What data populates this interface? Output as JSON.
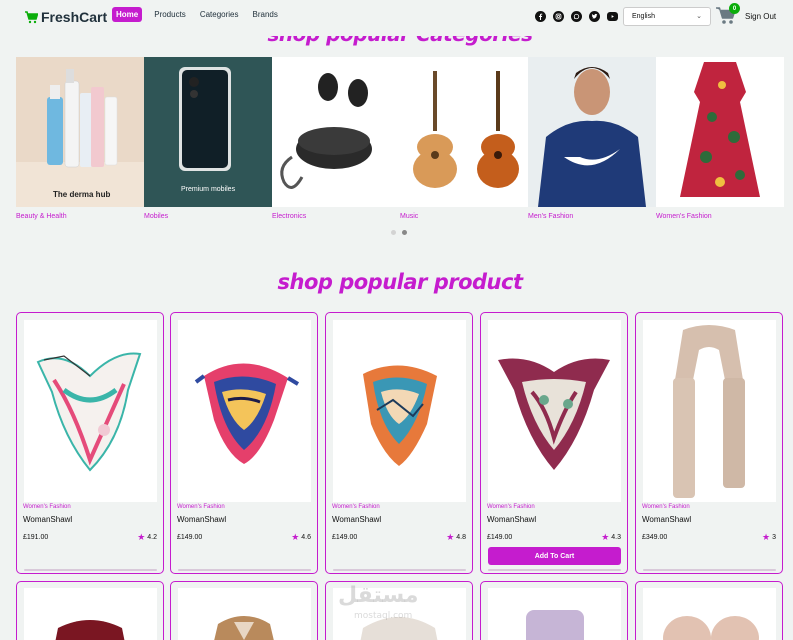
{
  "brand": {
    "name": "FreshCart",
    "icon": "cart-icon",
    "color": "#0aad0a"
  },
  "nav": {
    "links": [
      "Home",
      "Products",
      "Categories",
      "Brands"
    ],
    "active": "Home"
  },
  "socials": [
    "facebook-icon",
    "instagram-icon",
    "whatsapp-icon",
    "twitter-icon",
    "youtube-icon"
  ],
  "language": {
    "selected": "English"
  },
  "cart": {
    "count": "0"
  },
  "signout_label": "Sign Out",
  "categories": {
    "title": "shop popular Categories",
    "items": [
      {
        "label": "Beauty & Health",
        "image_text": "The derma hub"
      },
      {
        "label": "Mobiles",
        "image_text": "Premium mobiles"
      },
      {
        "label": "Electronics",
        "image_text": ""
      },
      {
        "label": "Music",
        "image_text": ""
      },
      {
        "label": "Men's Fashion",
        "image_text": ""
      },
      {
        "label": "Women's Fashion",
        "image_text": ""
      }
    ],
    "dots": 2,
    "active_dot": 1
  },
  "products": {
    "title": "shop popular product",
    "items": [
      {
        "category": "Women's Fashion",
        "name": "WomanShawl",
        "price": "£191.00",
        "rating": "4.2"
      },
      {
        "category": "Women's Fashion",
        "name": "WomanShawl",
        "price": "£149.00",
        "rating": "4.6"
      },
      {
        "category": "Women's Fashion",
        "name": "WomanShawl",
        "price": "£149.00",
        "rating": "4.8"
      },
      {
        "category": "Women's Fashion",
        "name": "WomanShawl",
        "price": "£149.00",
        "rating": "4.3",
        "button": "Add To Cart"
      },
      {
        "category": "Women's Fashion",
        "name": "WomanShawl",
        "price": "£349.00",
        "rating": "3"
      }
    ]
  },
  "watermark": {
    "text": "مستقل",
    "sub": "mostaql.com"
  },
  "colors": {
    "accent": "#c51cce",
    "bg": "#f0f3f2"
  }
}
